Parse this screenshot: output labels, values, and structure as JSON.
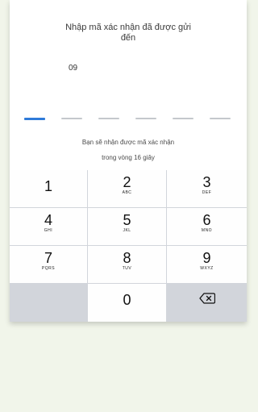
{
  "verification": {
    "prompt_line1": "Nhập mã xác nhận đã được gửi",
    "prompt_line2": "đến",
    "phone_number": "09",
    "code_length": 6,
    "active_slot": 0,
    "hint_line1": "Bạn sẽ nhận được mã xác nhận",
    "hint_line2": "trong vòng 16 giây"
  },
  "keypad": {
    "keys": [
      {
        "digit": "1",
        "letters": ""
      },
      {
        "digit": "2",
        "letters": "ABC"
      },
      {
        "digit": "3",
        "letters": "DEF"
      },
      {
        "digit": "4",
        "letters": "GHI"
      },
      {
        "digit": "5",
        "letters": "JKL"
      },
      {
        "digit": "6",
        "letters": "MNO"
      },
      {
        "digit": "7",
        "letters": "PQRS"
      },
      {
        "digit": "8",
        "letters": "TUV"
      },
      {
        "digit": "9",
        "letters": "WXYZ"
      },
      {
        "digit": "0",
        "letters": ""
      }
    ],
    "delete_icon": "backspace-icon"
  },
  "colors": {
    "background": "#f1f5ea",
    "active_slot": "#2f7bd9",
    "inactive_slot": "#c4c8cc",
    "keypad_bg": "#d2d5db"
  }
}
